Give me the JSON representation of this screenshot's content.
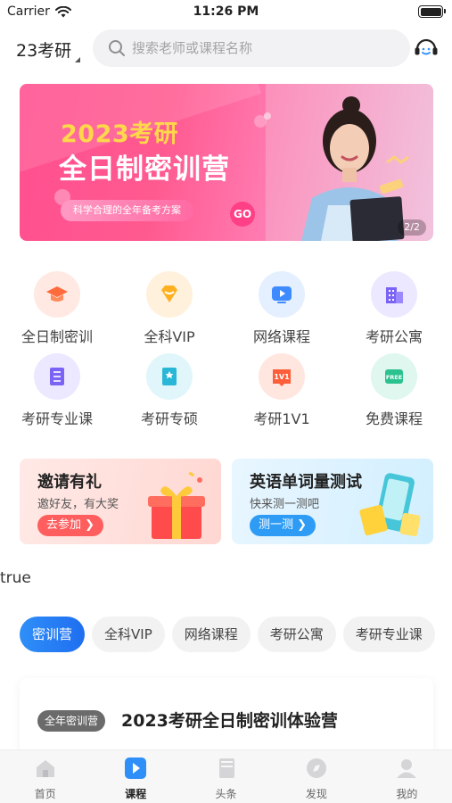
{
  "status_bar": {
    "carrier": "Carrier",
    "time": "11:26 PM"
  },
  "header": {
    "city": "23考研",
    "search_placeholder": "搜索老师或课程名称"
  },
  "banner": {
    "year_text": "2023考研",
    "title": "全日制密训营",
    "subtitle": "科学合理的全年备考方案",
    "go_label": "GO",
    "pager": "2/2"
  },
  "categories": [
    {
      "label": "全日制密训",
      "color": "#ff6b3d",
      "bg": "#ffe9e2",
      "icon": "graduation-cap-icon"
    },
    {
      "label": "全科VIP",
      "color": "#ffb020",
      "bg": "#fff1dc",
      "icon": "diamond-icon"
    },
    {
      "label": "网络课程",
      "color": "#3d8bff",
      "bg": "#e4efff",
      "icon": "video-play-icon"
    },
    {
      "label": "考研公寓",
      "color": "#7a63f5",
      "bg": "#ece8ff",
      "icon": "building-icon"
    },
    {
      "label": "考研专业课",
      "color": "#7a63f5",
      "bg": "#ece8ff",
      "icon": "book-stack-icon"
    },
    {
      "label": "考研专硕",
      "color": "#2ab6d6",
      "bg": "#e0f6fa",
      "icon": "bookmark-book-icon"
    },
    {
      "label": "考研1V1",
      "color": "#ff5e3a",
      "bg": "#ffe6df",
      "icon": "one-on-one-icon"
    },
    {
      "label": "免费课程",
      "color": "#2cc28e",
      "bg": "#dff7ee",
      "icon": "free-tag-icon"
    }
  ],
  "promos": {
    "invite": {
      "title": "邀请有礼",
      "subtitle": "邀好友，有大奖",
      "button": "去参加 ❯"
    },
    "vocab": {
      "title": "英语单词量测试",
      "subtitle": "快来测一测吧",
      "button": "测一测 ❯"
    }
  },
  "stray_text": "true",
  "course_tabs": [
    "密训营",
    "全科VIP",
    "网络课程",
    "考研公寓",
    "考研专业课"
  ],
  "course_card": {
    "tag": "全年密训营",
    "title": "2023考研全日制密训体验营"
  },
  "bottom_nav": [
    {
      "label": "首页",
      "icon": "home-icon"
    },
    {
      "label": "课程",
      "icon": "course-play-icon"
    },
    {
      "label": "头条",
      "icon": "news-book-icon"
    },
    {
      "label": "发现",
      "icon": "discover-icon"
    },
    {
      "label": "我的",
      "icon": "profile-icon"
    }
  ],
  "colors": {
    "accent": "#1f6ef0",
    "banner_pink": "#ff4f8f"
  }
}
